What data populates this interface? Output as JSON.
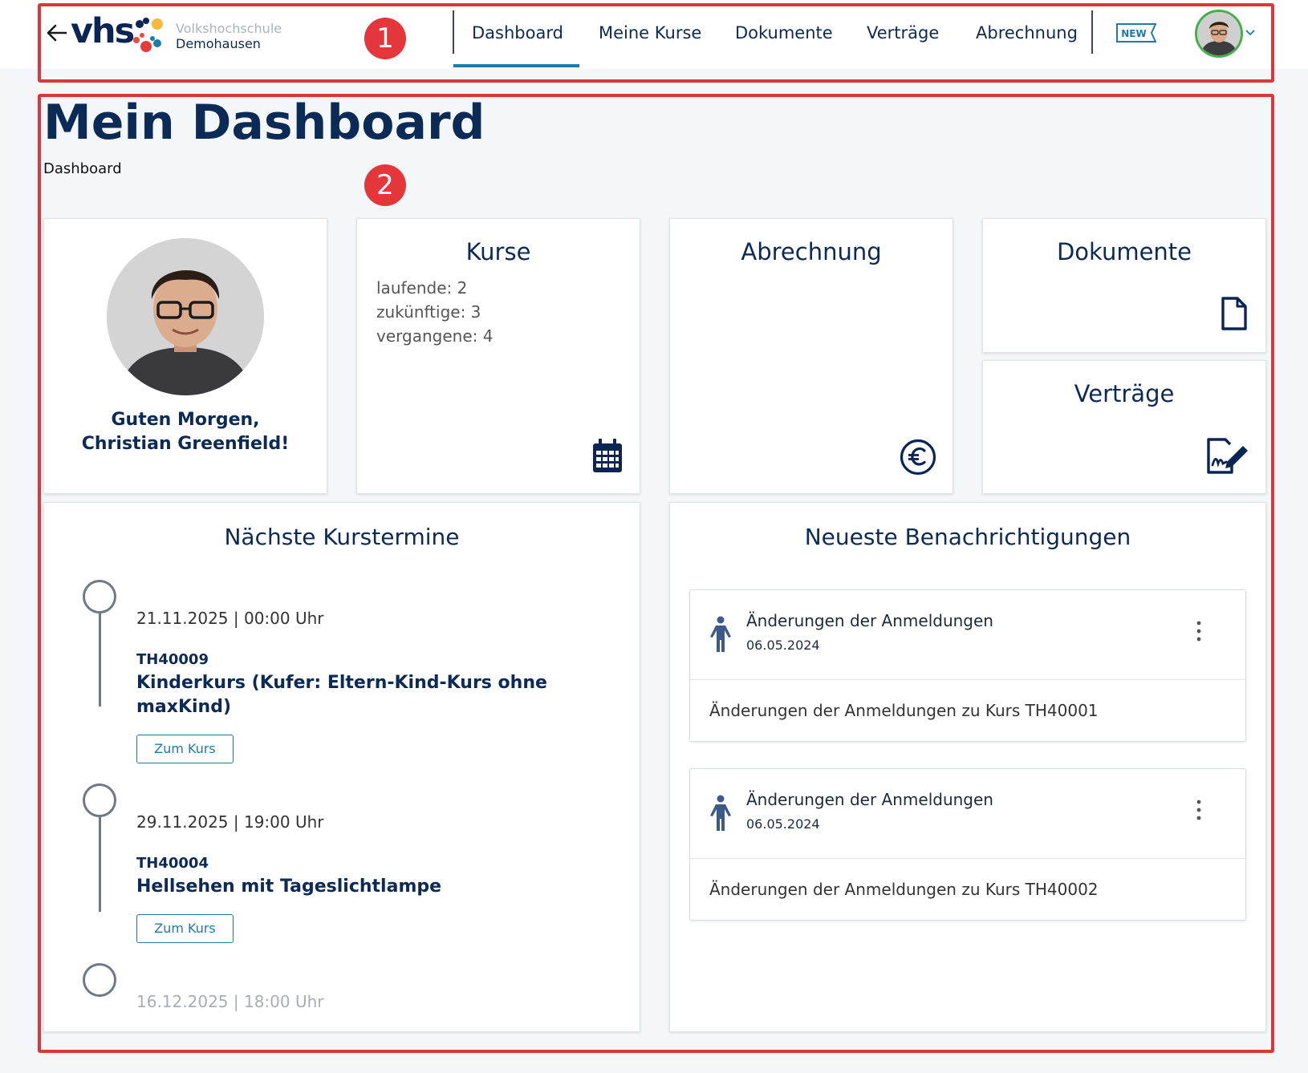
{
  "header": {
    "logo_text": "vhs",
    "logo_line1": "Volkshochschule",
    "logo_line2": "Demohausen",
    "nav": [
      "Dashboard",
      "Meine Kurse",
      "Dokumente",
      "Verträge",
      "Abrechnung"
    ],
    "active_nav": "Dashboard",
    "new_badge": "NEW"
  },
  "annotations": [
    "1",
    "2"
  ],
  "page": {
    "title": "Mein Dashboard",
    "breadcrumb": "Dashboard"
  },
  "profile": {
    "greeting_line1": "Guten Morgen,",
    "greeting_line2": "Christian Greenfield!"
  },
  "kurse": {
    "title": "Kurse",
    "stats": [
      "laufende: 2",
      "zukünftige: 3",
      "vergangene: 4"
    ]
  },
  "abrechnung": {
    "title": "Abrechnung"
  },
  "dokumente": {
    "title": "Dokumente"
  },
  "vertraege": {
    "title": "Verträge"
  },
  "termine": {
    "title": "Nächste Kurstermine",
    "items": [
      {
        "date": "21.11.2025 | 00:00 Uhr",
        "code": "TH40009",
        "title_line1": "Kinderkurs (Kufer: Eltern-Kind-Kurs ohne",
        "title_line2": "maxKind)",
        "button": "Zum Kurs"
      },
      {
        "date": "29.11.2025 | 19:00 Uhr",
        "code": "TH40004",
        "title_line1": "Hellsehen mit Tageslichtlampe",
        "button": "Zum Kurs"
      },
      {
        "date": "16.12.2025 | 18:00 Uhr"
      }
    ]
  },
  "notifications": {
    "title": "Neueste Benachrichtigungen",
    "items": [
      {
        "title": "Änderungen der Anmeldungen",
        "date": "06.05.2024",
        "body": "Änderungen der Anmeldungen zu Kurs TH40001"
      },
      {
        "title": "Änderungen der Anmeldungen",
        "date": "06.05.2024",
        "body": "Änderungen der Anmeldungen zu Kurs TH40002"
      }
    ]
  },
  "colors": {
    "brand_navy": "#0b2a55",
    "accent_blue": "#1f7ba6",
    "annotation_red": "#d9363e",
    "avatar_ring": "#43b04a"
  }
}
